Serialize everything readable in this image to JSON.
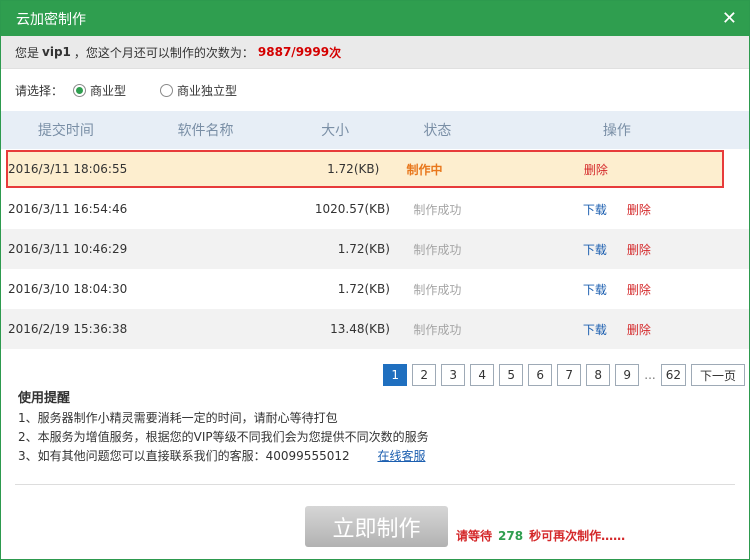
{
  "window": {
    "title": "云加密制作"
  },
  "quota": {
    "prefix": "您是",
    "user": "vip1",
    "middle": "，您这个月还可以制作的次数为：",
    "count": "9887/9999",
    "unit": "次"
  },
  "select": {
    "label": "请选择：",
    "options": [
      {
        "label": "商业型",
        "checked": true
      },
      {
        "label": "商业独立型",
        "checked": false
      }
    ]
  },
  "table": {
    "headers": [
      "提交时间",
      "软件名称",
      "大小",
      "状态",
      "操作"
    ],
    "rows": [
      {
        "time": "2016/3/11 18:06:55",
        "name": "",
        "size": "1.72(KB)",
        "status": "制作中",
        "download": "",
        "delete": "删除"
      },
      {
        "time": "2016/3/11 16:54:46",
        "name": "",
        "size": "1020.57(KB)",
        "status": "制作成功",
        "download": "下载",
        "delete": "删除"
      },
      {
        "time": "2016/3/11 10:46:29",
        "name": "",
        "size": "1.72(KB)",
        "status": "制作成功",
        "download": "下载",
        "delete": "删除"
      },
      {
        "time": "2016/3/10 18:04:30",
        "name": "",
        "size": "1.72(KB)",
        "status": "制作成功",
        "download": "下载",
        "delete": "删除"
      },
      {
        "time": "2016/2/19 15:36:38",
        "name": "",
        "size": "13.48(KB)",
        "status": "制作成功",
        "download": "下载",
        "delete": "删除"
      }
    ]
  },
  "pagination": {
    "pages": [
      "1",
      "2",
      "3",
      "4",
      "5",
      "6",
      "7",
      "8",
      "9"
    ],
    "ellipsis": "...",
    "last": "62",
    "next": "下一页"
  },
  "tips": {
    "title": "使用提醒",
    "items": [
      "1、服务器制作小精灵需要消耗一定的时间，请耐心等待打包",
      "2、本服务为增值服务，根据您的VIP等级不同我们会为您提供不同次数的服务",
      "3、如有其他问题您可以直接联系我们的客服：40099555012"
    ],
    "online_service": "在线客服"
  },
  "action": {
    "make_button": "立即制作",
    "wait_prefix": "请等待",
    "wait_seconds": "278",
    "wait_suffix": "秒可再次制作……"
  },
  "colors": {
    "accent": "#2f9e4f",
    "danger": "#d4282a",
    "link": "#1c5fb0",
    "processing": "#e8771c"
  },
  "icons": {
    "close": "close-icon"
  }
}
